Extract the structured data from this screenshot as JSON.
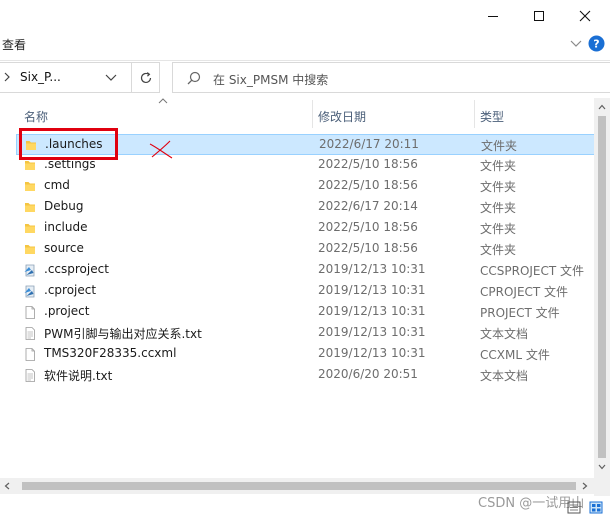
{
  "ribbon": {
    "tab_label": "查看"
  },
  "address": {
    "path": "Six_P..."
  },
  "search": {
    "placeholder": "在 Six_PMSM 中搜索"
  },
  "columns": {
    "name": "名称",
    "date": "修改日期",
    "type": "类型"
  },
  "files": [
    {
      "name": ".launches",
      "date": "2022/6/17 20:11",
      "type": "文件夹",
      "icon": "folder-icon",
      "selected": true
    },
    {
      "name": ".settings",
      "date": "2022/5/10 18:56",
      "type": "文件夹",
      "icon": "folder-icon"
    },
    {
      "name": "cmd",
      "date": "2022/5/10 18:56",
      "type": "文件夹",
      "icon": "folder-icon"
    },
    {
      "name": "Debug",
      "date": "2022/6/17 20:14",
      "type": "文件夹",
      "icon": "folder-icon"
    },
    {
      "name": "include",
      "date": "2022/5/10 18:56",
      "type": "文件夹",
      "icon": "folder-icon"
    },
    {
      "name": "source",
      "date": "2022/5/10 18:56",
      "type": "文件夹",
      "icon": "folder-icon"
    },
    {
      "name": ".ccsproject",
      "date": "2019/12/13 10:31",
      "type": "CCSPROJECT 文件",
      "icon": "project-file-icon"
    },
    {
      "name": ".cproject",
      "date": "2019/12/13 10:31",
      "type": "CPROJECT 文件",
      "icon": "project-file-icon"
    },
    {
      "name": ".project",
      "date": "2019/12/13 10:31",
      "type": "PROJECT 文件",
      "icon": "file-icon"
    },
    {
      "name": "PWM引脚与输出对应关系.txt",
      "date": "2019/12/13 10:31",
      "type": "文本文档",
      "icon": "text-file-icon"
    },
    {
      "name": "TMS320F28335.ccxml",
      "date": "2019/12/13 10:31",
      "type": "CCXML 文件",
      "icon": "file-icon"
    },
    {
      "name": "软件说明.txt",
      "date": "2020/6/20 20:51",
      "type": "文本文档",
      "icon": "text-file-icon"
    }
  ],
  "watermark": "CSDN @一试用山",
  "colors": {
    "selection": "#cce8ff",
    "selection_border": "#99d1ff",
    "annotation_red": "#e0000f",
    "folder": "#f4c542"
  }
}
